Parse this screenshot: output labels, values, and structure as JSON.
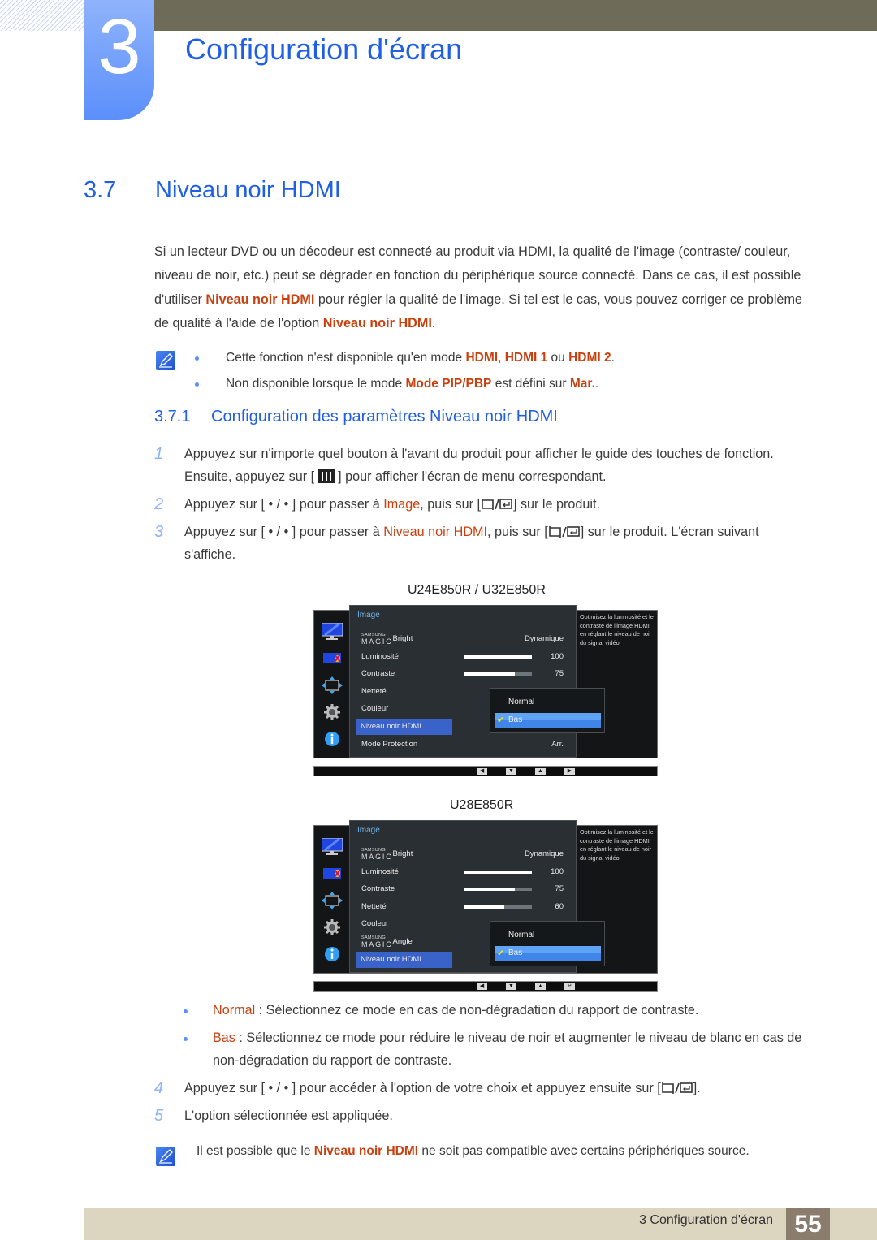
{
  "header": {
    "chapter_number": "3",
    "chapter_title": "Configuration d'écran"
  },
  "section": {
    "number": "3.7",
    "title": "Niveau noir HDMI"
  },
  "intro": {
    "parts": [
      "Si un lecteur DVD ou un décodeur est connecté au produit via HDMI, la qualité de l'image (contraste/ couleur, niveau de noir, etc.) peut se dégrader en fonction du périphérique source connecté. Dans ce cas, il est possible d'utiliser ",
      "Niveau noir HDMI",
      " pour régler la qualité de l'image. Si tel est le cas, vous pouvez corriger ce problème de qualité à l'aide de l'option ",
      "Niveau noir HDMI",
      "."
    ]
  },
  "notes_top": [
    {
      "pre": "Cette fonction n'est disponible qu'en mode ",
      "h1": "HDMI",
      "mid1": ", ",
      "h2": "HDMI 1",
      "mid2": " ou ",
      "h3": "HDMI 2",
      "post": "."
    },
    {
      "pre": "Non disponible lorsque le mode ",
      "h1": "Mode PIP/PBP",
      "mid1": " est défini sur ",
      "h2": "Mar.",
      "post": "."
    }
  ],
  "subsection": {
    "number": "3.7.1",
    "title": "Configuration des paramètres Niveau noir HDMI"
  },
  "steps": [
    {
      "n": "1",
      "a": "Appuyez sur n'importe quel bouton à l'avant du produit pour afficher le guide des touches de fonction. Ensuite, appuyez sur [ ",
      "b": " ] pour afficher l'écran de menu correspondant."
    },
    {
      "n": "2",
      "a": "Appuyez sur [ • / • ] pour passer à ",
      "h": "Image",
      "b": ", puis sur [",
      "c": "] sur le produit."
    },
    {
      "n": "3",
      "a": "Appuyez sur [ • / • ] pour passer à ",
      "h": "Niveau noir HDMI",
      "b": ", puis sur [",
      "c": "] sur le produit. L'écran suivant s'affiche."
    },
    {
      "n": "4",
      "a": "Appuyez sur [ • / • ] pour accéder à l'option de votre choix et appuyez ensuite sur [",
      "c": "]."
    },
    {
      "n": "5",
      "a": "L'option sélectionnée est appliquée."
    }
  ],
  "osd_screens": [
    {
      "model": "U24E850R / U32E850R",
      "category": "Image",
      "rows": [
        {
          "label": "Bright",
          "magic": true,
          "value": "Dynamique"
        },
        {
          "label": "Luminosité",
          "value": "100",
          "bar": 1.0
        },
        {
          "label": "Contraste",
          "value": "75",
          "bar": 0.75
        },
        {
          "label": "Netteté"
        },
        {
          "label": "Couleur"
        },
        {
          "label": "Niveau noir HDMI",
          "selected": true
        },
        {
          "label": "Mode Protection",
          "value": "Arr."
        }
      ],
      "dropdown": {
        "options": [
          "Normal",
          "Bas"
        ],
        "selected": "Bas"
      },
      "help": "Optimisez la luminosité et le contraste de l'image HDMI en réglant le niveau de noir du signal vidéo.",
      "keys": [
        "◀",
        "▼",
        "▲",
        "▶"
      ]
    },
    {
      "model": "U28E850R",
      "category": "Image",
      "rows": [
        {
          "label": "Bright",
          "magic": true,
          "value": "Dynamique"
        },
        {
          "label": "Luminosité",
          "value": "100",
          "bar": 1.0
        },
        {
          "label": "Contraste",
          "value": "75",
          "bar": 0.75
        },
        {
          "label": "Netteté",
          "value": "60",
          "bar": 0.6
        },
        {
          "label": "Couleur"
        },
        {
          "label": "Angle",
          "magic": true
        },
        {
          "label": "Niveau noir HDMI",
          "selected": true
        }
      ],
      "dropdown": {
        "options": [
          "Normal",
          "Bas"
        ],
        "selected": "Bas"
      },
      "help": "Optimisez la luminosité et le contraste de l'image HDMI en réglant le niveau de noir du signal vidéo.",
      "keys": [
        "◀",
        "▼",
        "▲",
        "↵"
      ]
    }
  ],
  "magic_brand": {
    "top": "SAMSUNG",
    "bottom": "MAGIC"
  },
  "options": [
    {
      "name": "Normal",
      "desc": " : Sélectionnez ce mode en cas de non-dégradation du rapport de contraste."
    },
    {
      "name": "Bas",
      "desc": " : Sélectionnez ce mode pour réduire le niveau de noir et augmenter le niveau de blanc en cas de non-dégradation du rapport de contraste."
    }
  ],
  "note_bottom": {
    "pre": "Il est possible que le ",
    "h": "Niveau noir HDMI",
    "post": " ne soit pas compatible avec certains périphériques source."
  },
  "footer": {
    "text": "3 Configuration d'écran",
    "page": "55"
  },
  "colors": {
    "accent_blue": "#1f5fe6",
    "highlight": "#c9400f",
    "chapter_block": "#5b8ffb",
    "topbar": "#6e6c58",
    "footer_bar": "#dcd5c0",
    "page_badge": "#8a7d6e"
  }
}
